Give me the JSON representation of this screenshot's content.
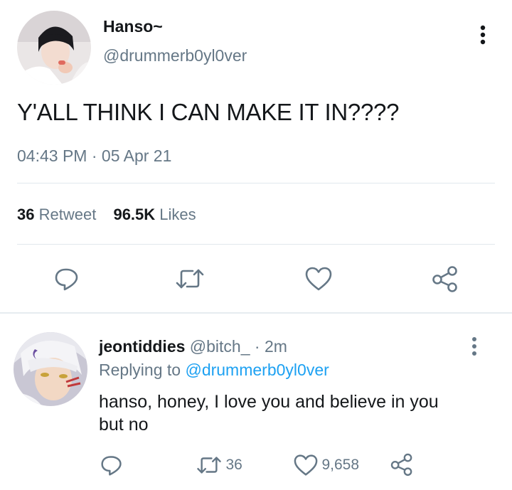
{
  "main_tweet": {
    "display_name": "Hanso~",
    "handle": "@drummerb0yl0ver",
    "text": "Y'ALL THINK I CAN MAKE IT IN????",
    "time": "04:43 PM",
    "separator": "·",
    "date": "05 Apr 21",
    "retweet_count": "36",
    "retweet_label": "Retweet",
    "like_count": "96.5K",
    "like_label": "Likes"
  },
  "reply": {
    "display_name": "jeontiddies",
    "handle": "@bitch_",
    "time_sep": "·",
    "time": "2m",
    "replying_prefix": "Replying to",
    "replying_to": "@drummerb0yl0ver",
    "text_line1": "hanso, honey, I love you and believe in you",
    "text_line2": "but no",
    "retweet_count": "36",
    "like_count": "9,658"
  },
  "colors": {
    "icon_gray": "#657786",
    "link_blue": "#1da1f2",
    "divider": "#e1e8ed"
  },
  "icons": {
    "reply": "speech-bubble-icon",
    "retweet": "retweet-arrows-icon",
    "like": "heart-icon",
    "share": "share-nodes-icon",
    "more": "vertical-dots-icon"
  }
}
